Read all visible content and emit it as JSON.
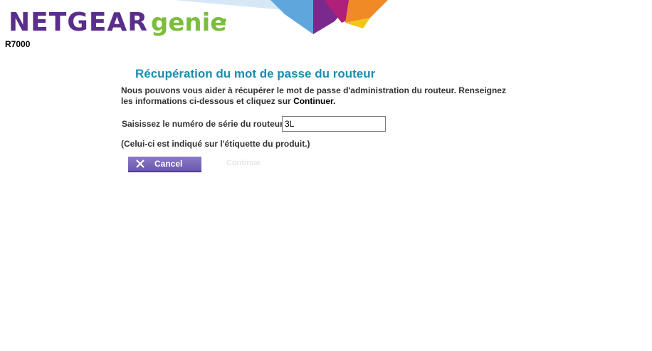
{
  "header": {
    "brand": "NETGEAR",
    "product": "genie",
    "model": "R7000"
  },
  "recovery": {
    "title": "Récupération du mot de passe du routeur",
    "intro_text": "Nous pouvons vous aider à récupérer le mot de passe d'administration du routeur. Renseignez les informations ci-dessous et cliquez sur ",
    "intro_emphasis": "Continuer.",
    "serial_label": "Saisissez le numéro de série du routeur",
    "serial_value": "3L",
    "note": "(Celui-ci est indiqué sur l'étiquette du produit.)"
  },
  "buttons": {
    "cancel_label": "Cancel",
    "continue_label": "Continue",
    "continue_enabled": false
  },
  "colors": {
    "brand_purple": "#5a2e8a",
    "genie_green": "#7dbd3c",
    "title_blue": "#1e8cb0",
    "button_purple": "#6a58ad"
  },
  "icons": {
    "cancel": "close-icon"
  }
}
